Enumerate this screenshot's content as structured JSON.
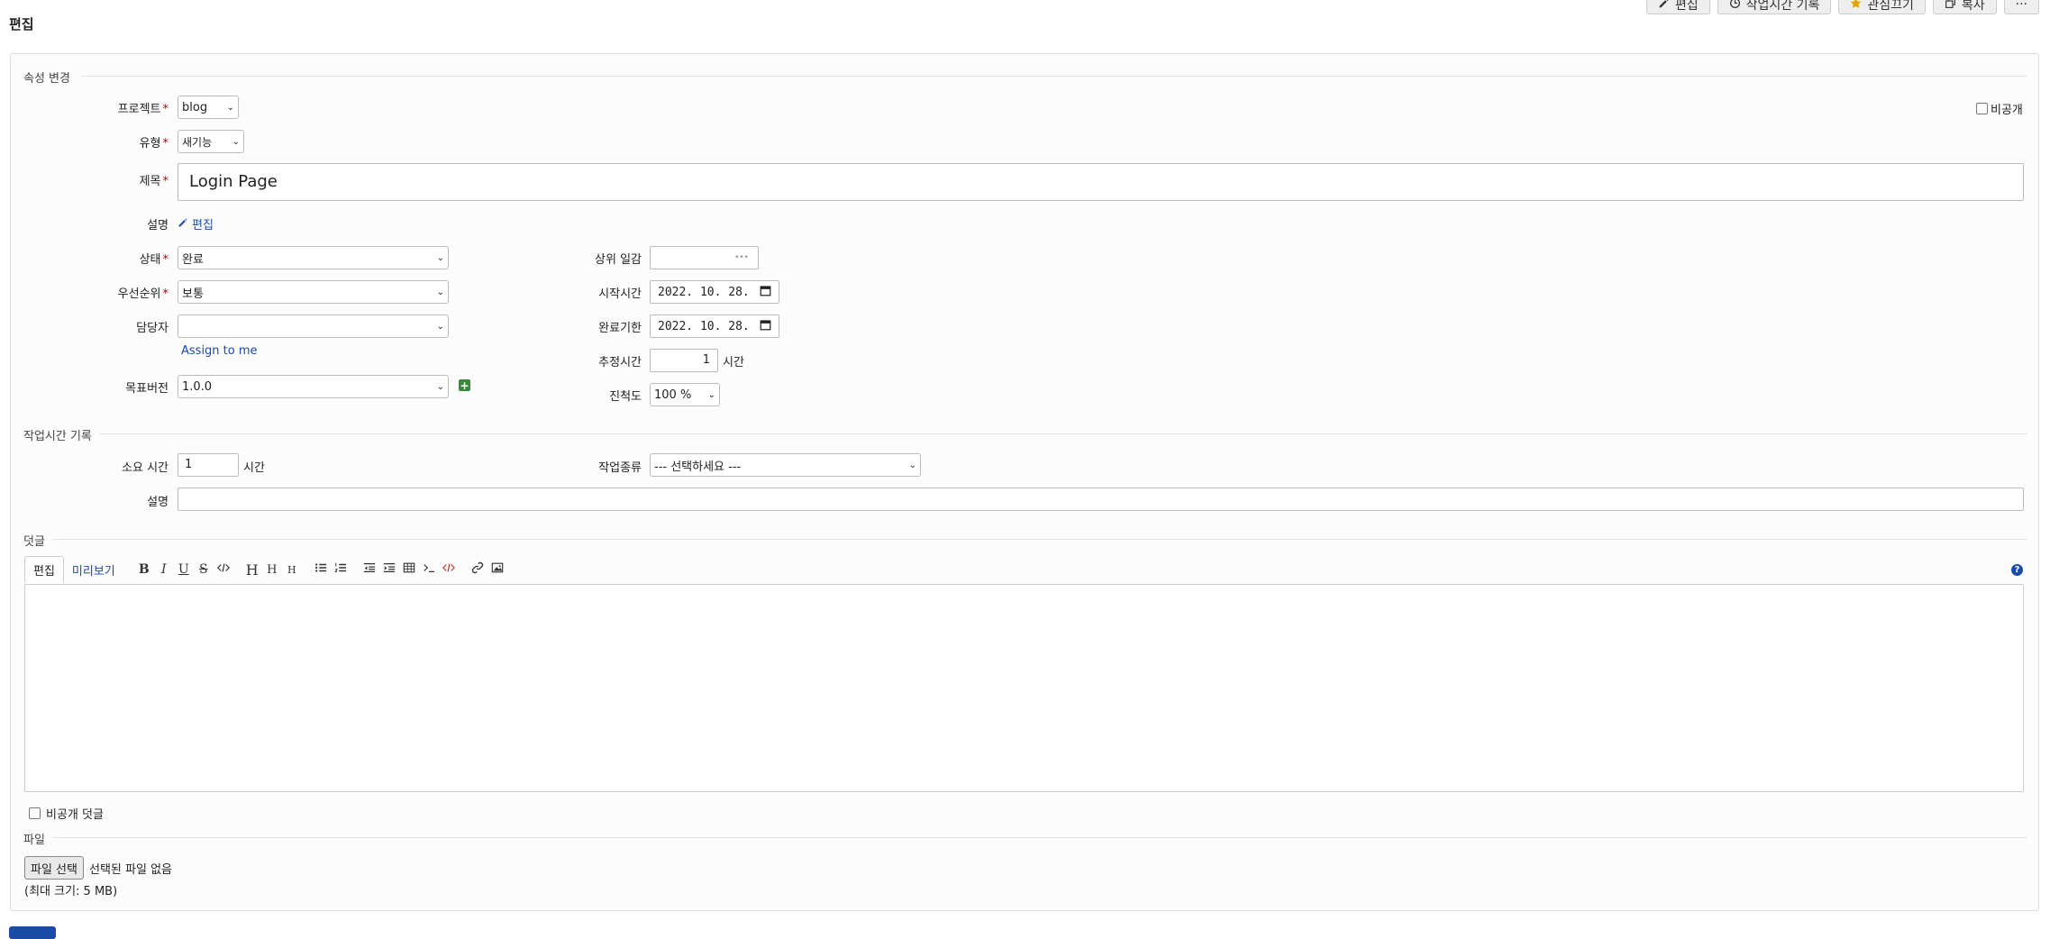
{
  "page": {
    "title": "편집"
  },
  "context_menu": {
    "edit": "편집",
    "log_time": "작업시간 기록",
    "watch": "관심끄기",
    "copy": "복사",
    "more": "···"
  },
  "attributes": {
    "legend": "속성 변경",
    "project": {
      "label": "프로젝트",
      "value": "blog"
    },
    "private": {
      "label": "비공개"
    },
    "tracker": {
      "label": "유형",
      "value": "새기능"
    },
    "subject": {
      "label": "제목",
      "value": "Login Page"
    },
    "description": {
      "label": "설명",
      "edit_link": "편집"
    },
    "status": {
      "label": "상태",
      "value": "완료"
    },
    "priority": {
      "label": "우선순위",
      "value": "보통"
    },
    "assignee": {
      "label": "담당자",
      "value": "",
      "assign_to_me": "Assign to me"
    },
    "target_version": {
      "label": "목표버전",
      "value": "1.0.0"
    },
    "parent_task": {
      "label": "상위 일감",
      "value": "",
      "dots": "•••"
    },
    "start_date": {
      "label": "시작시간",
      "value": "2022. 10. 28."
    },
    "due_date": {
      "label": "완료기한",
      "value": "2022. 10. 28."
    },
    "estimated_time": {
      "label": "추정시간",
      "value": "1",
      "unit": "시간"
    },
    "done_ratio": {
      "label": "진척도",
      "value": "100 %"
    }
  },
  "time_entry": {
    "legend": "작업시간 기록",
    "spent": {
      "label": "소요 시간",
      "value": "1",
      "unit": "시간"
    },
    "activity": {
      "label": "작업종류",
      "value": "--- 선택하세요 ---"
    },
    "comment": {
      "label": "설명",
      "value": ""
    }
  },
  "notes": {
    "legend": "덧글",
    "tab_edit": "편집",
    "tab_preview": "미리보기",
    "toolbar": {
      "bold": "B",
      "italic": "I",
      "underline": "U",
      "strike": "S",
      "h1": "H",
      "h2": "H",
      "h3": "H"
    },
    "private_notes": "비공개 덧글"
  },
  "files": {
    "legend": "파일",
    "choose_button": "파일 선택",
    "no_file": "선택된 파일 없음",
    "max_size": "(최대 크기: 5 MB)"
  },
  "colors": {
    "link": "#1a4ba8",
    "required": "#bb0000",
    "add": "#3b8a3b"
  }
}
